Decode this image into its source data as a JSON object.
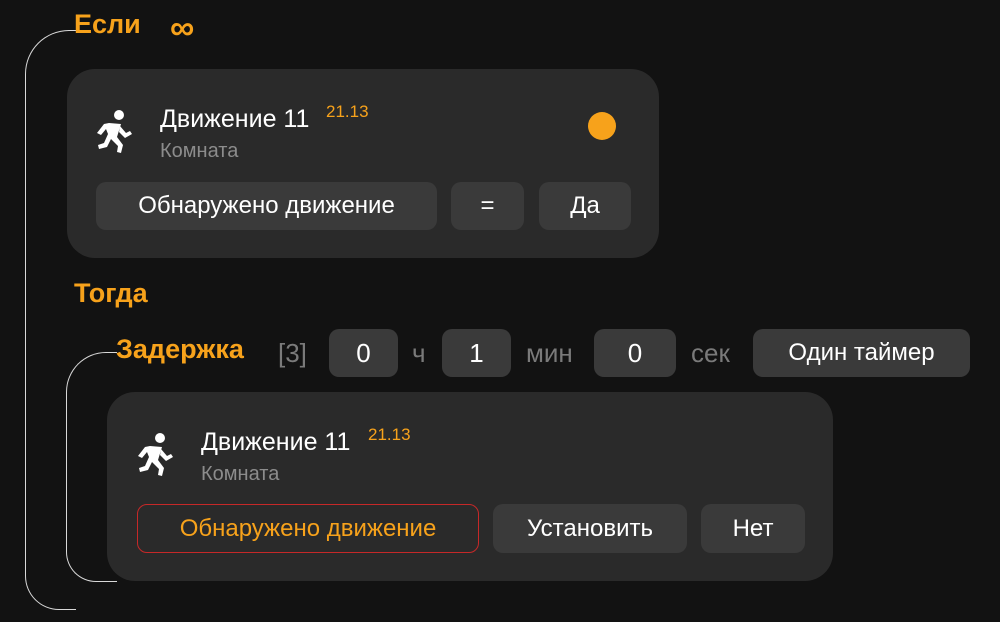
{
  "if_section": {
    "label": "Если",
    "repeat_icon": "infinity-icon",
    "repeat_glyph": "∞"
  },
  "condition_card": {
    "device_name": "Движение 11",
    "device_version": "21.13",
    "room": "Комната",
    "icon": "running-person-icon",
    "status": "active",
    "property": "Обнаружено движение",
    "operator": "=",
    "value": "Да"
  },
  "then_section": {
    "label": "Тогда"
  },
  "delay": {
    "label": "Задержка",
    "index": "[3]",
    "hours_value": "0",
    "hours_unit": "ч",
    "minutes_value": "1",
    "minutes_unit": "мин",
    "seconds_value": "0",
    "seconds_unit": "сек",
    "timer_mode": "Один таймер"
  },
  "action_card": {
    "device_name": "Движение 11",
    "device_version": "21.13",
    "room": "Комната",
    "icon": "running-person-icon",
    "property": "Обнаружено движение",
    "action": "Установить",
    "value": "Нет"
  },
  "colors": {
    "accent": "#f7a21b",
    "error_border": "#c62828",
    "card": "#2a2a2a",
    "chip": "#3a3a3a"
  }
}
